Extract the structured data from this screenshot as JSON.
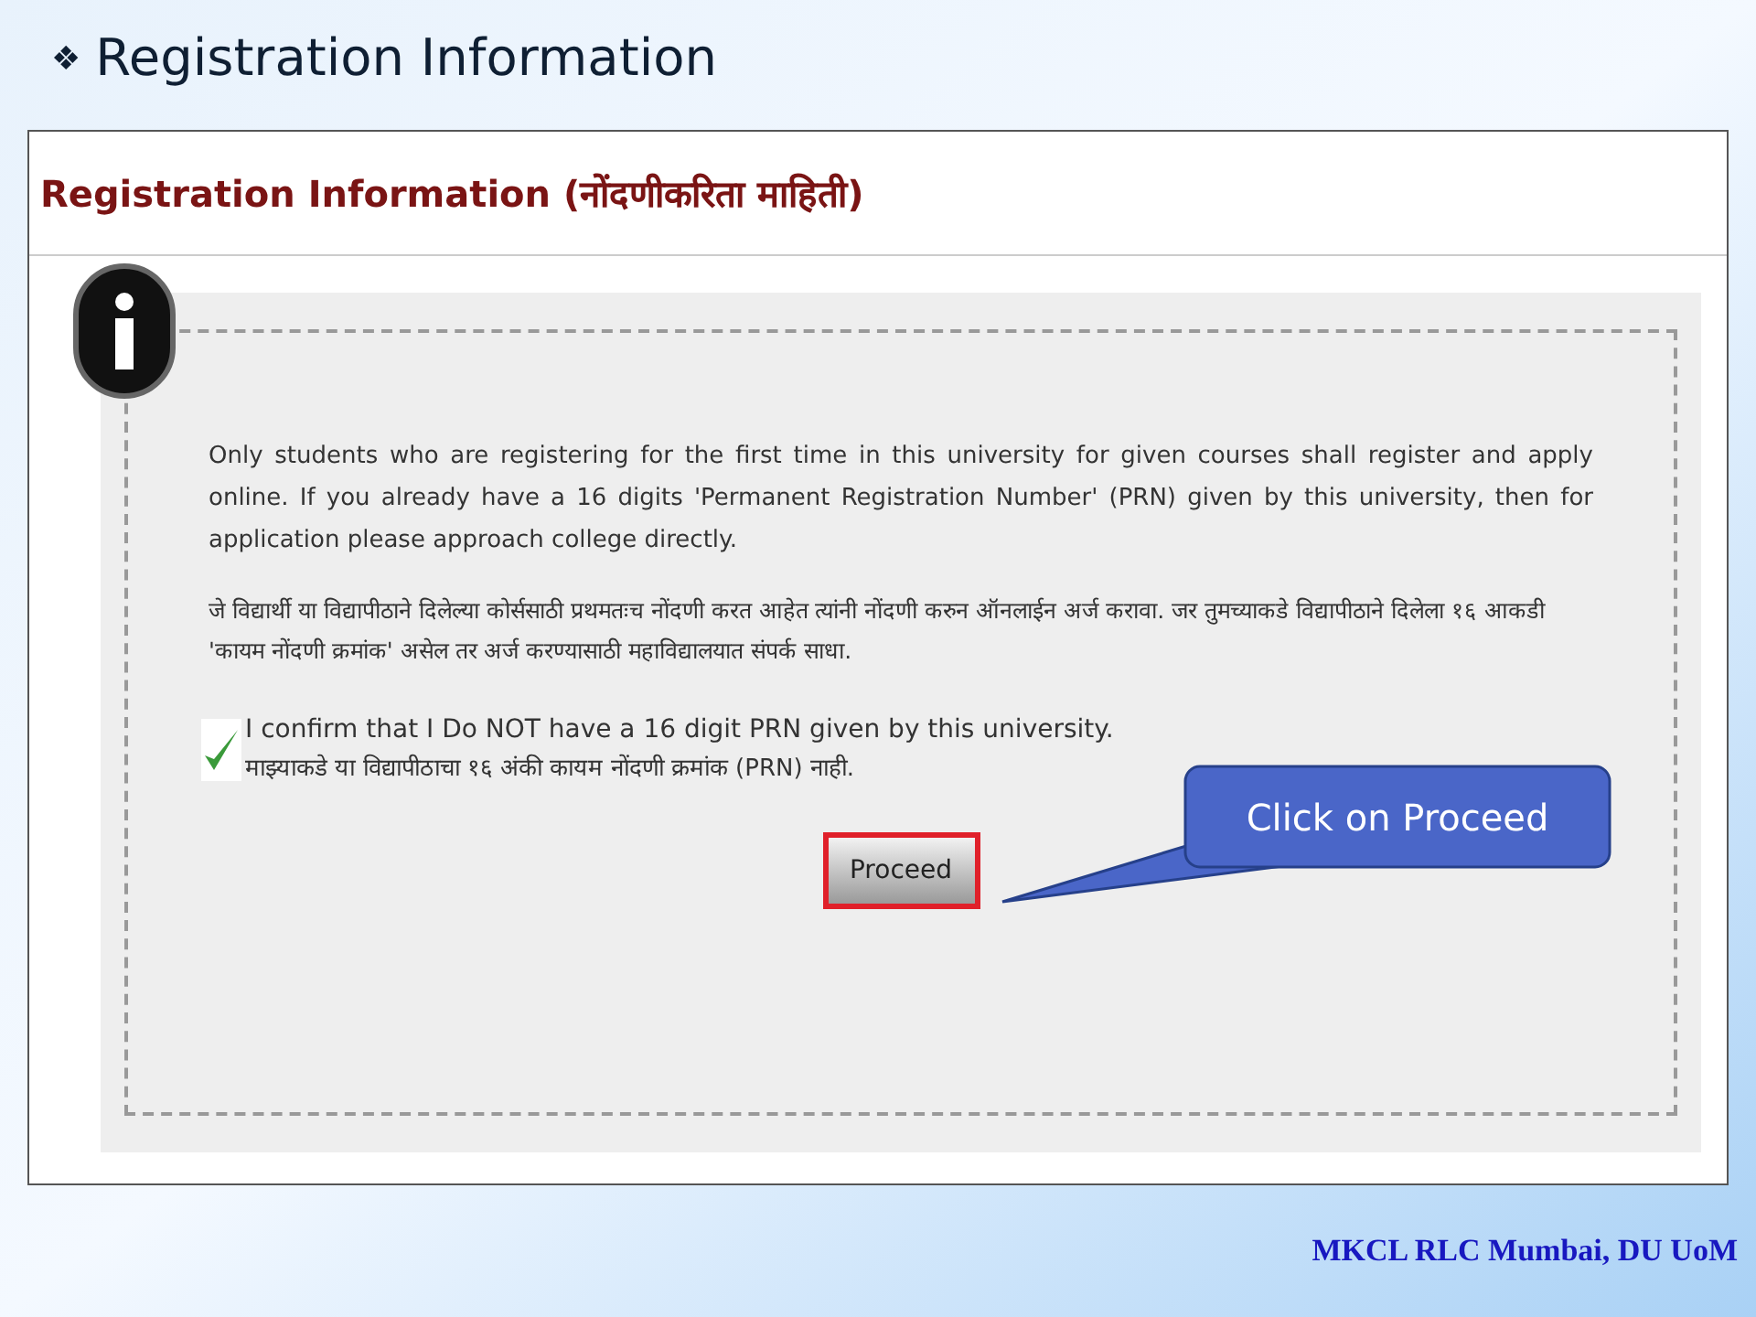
{
  "slide": {
    "bullet": "❖",
    "title": "Registration Information"
  },
  "form": {
    "title": "Registration Information (नोंदणीकरिता माहिती)",
    "paragraph_en": "Only students who are registering for the first time in this university for given courses shall register and apply online. If you already have a 16 digits 'Permanent Registration Number' (PRN) given by this university, then for application please approach college directly.",
    "paragraph_mr": "जे विद्यार्थी या विद्यापीठाने दिलेल्या कोर्ससाठी प्रथमतःच नोंदणी करत आहेत त्यांनी नोंदणी करुन ऑनलाईन अर्ज करावा. जर तुमच्याकडे विद्यापीठाने दिलेला १६ आकडी 'कायम नोंदणी क्रमांक' असेल तर अर्ज करण्यासाठी महाविद्यालयात संपर्क साधा.",
    "confirm": {
      "checked": true,
      "label_en": "I confirm that I Do NOT have a 16 digit PRN given by this university.",
      "label_mr": "माझ्याकडे या विद्यापीठाचा १६ अंकी कायम नोंदणी क्रमांक (PRN) नाही."
    },
    "button": "Proceed"
  },
  "callout": "Click on Proceed",
  "footer": "MKCL RLC Mumbai, DU UoM"
}
